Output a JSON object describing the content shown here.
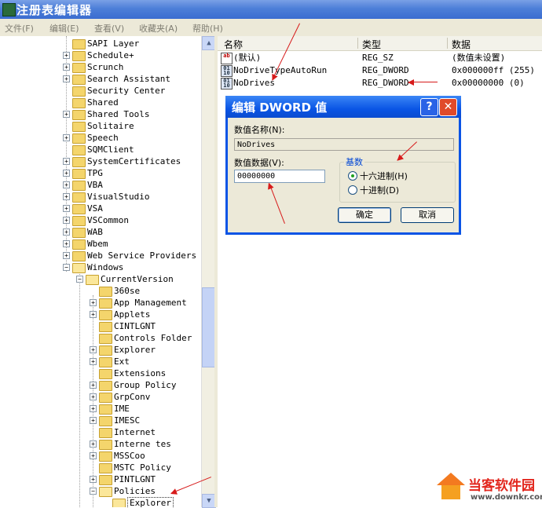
{
  "window": {
    "title": "注册表编辑器"
  },
  "menu": [
    "文件(F)",
    "编辑(E)",
    "查看(V)",
    "收藏夹(A)",
    "帮助(H)"
  ],
  "tree": [
    {
      "label": "SAPI Layer",
      "indent": 0,
      "exp": ""
    },
    {
      "label": "Schedule+",
      "indent": 0,
      "exp": "+"
    },
    {
      "label": "Scrunch",
      "indent": 0,
      "exp": "+"
    },
    {
      "label": "Search Assistant",
      "indent": 0,
      "exp": "+"
    },
    {
      "label": "Security Center",
      "indent": 0,
      "exp": ""
    },
    {
      "label": "Shared",
      "indent": 0,
      "exp": ""
    },
    {
      "label": "Shared Tools",
      "indent": 0,
      "exp": "+"
    },
    {
      "label": "Solitaire",
      "indent": 0,
      "exp": ""
    },
    {
      "label": "Speech",
      "indent": 0,
      "exp": "+"
    },
    {
      "label": "SQMClient",
      "indent": 0,
      "exp": ""
    },
    {
      "label": "SystemCertificates",
      "indent": 0,
      "exp": "+"
    },
    {
      "label": "TPG",
      "indent": 0,
      "exp": "+"
    },
    {
      "label": "VBA",
      "indent": 0,
      "exp": "+"
    },
    {
      "label": "VisualStudio",
      "indent": 0,
      "exp": "+"
    },
    {
      "label": "VSA",
      "indent": 0,
      "exp": "+"
    },
    {
      "label": "VSCommon",
      "indent": 0,
      "exp": "+"
    },
    {
      "label": "WAB",
      "indent": 0,
      "exp": "+"
    },
    {
      "label": "Wbem",
      "indent": 0,
      "exp": "+"
    },
    {
      "label": "Web Service Providers",
      "indent": 0,
      "exp": "+"
    },
    {
      "label": "Windows",
      "indent": 0,
      "exp": "-",
      "open": true
    },
    {
      "label": "CurrentVersion",
      "indent": 1,
      "exp": "-",
      "open": true
    },
    {
      "label": "360se",
      "indent": 2,
      "exp": ""
    },
    {
      "label": "App Management",
      "indent": 2,
      "exp": "+"
    },
    {
      "label": "Applets",
      "indent": 2,
      "exp": "+"
    },
    {
      "label": "CINTLGNT",
      "indent": 2,
      "exp": ""
    },
    {
      "label": "Controls Folder",
      "indent": 2,
      "exp": ""
    },
    {
      "label": "Explorer",
      "indent": 2,
      "exp": "+"
    },
    {
      "label": "Ext",
      "indent": 2,
      "exp": "+"
    },
    {
      "label": "Extensions",
      "indent": 2,
      "exp": ""
    },
    {
      "label": "Group Policy",
      "indent": 2,
      "exp": "+"
    },
    {
      "label": "GrpConv",
      "indent": 2,
      "exp": "+"
    },
    {
      "label": "IME",
      "indent": 2,
      "exp": "+"
    },
    {
      "label": "IMESC",
      "indent": 2,
      "exp": "+"
    },
    {
      "label": "Internet",
      "indent": 2,
      "exp": ""
    },
    {
      "label": "Interne tes",
      "indent": 2,
      "exp": "+"
    },
    {
      "label": "MSSCoo",
      "indent": 2,
      "exp": "+"
    },
    {
      "label": "MSTC Policy",
      "indent": 2,
      "exp": ""
    },
    {
      "label": "PINTLGNT",
      "indent": 2,
      "exp": "+"
    },
    {
      "label": "Policies",
      "indent": 2,
      "exp": "-",
      "open": true
    },
    {
      "label": "Explorer",
      "indent": 3,
      "exp": "",
      "open": true,
      "selected": true
    }
  ],
  "columns": {
    "name": "名称",
    "type": "类型",
    "data": "数据"
  },
  "values": [
    {
      "icon": "ab",
      "name": "(默认)",
      "type": "REG_SZ",
      "data": "(数值未设置)"
    },
    {
      "icon": "dw",
      "name": "NoDriveTypeAutoRun",
      "type": "REG_DWORD",
      "data": "0x000000ff (255)"
    },
    {
      "icon": "dw",
      "name": "NoDrives",
      "type": "REG_DWORD",
      "data": "0x00000000 (0)"
    }
  ],
  "dialog": {
    "title": "编辑 DWORD 值",
    "help": "?",
    "close": "✕",
    "name_label": "数值名称(N):",
    "name_value": "NoDrives",
    "data_label": "数值数据(V):",
    "data_value": "00000000",
    "base_label": "基数",
    "hex_label": "十六进制(H)",
    "dec_label": "十进制(D)",
    "base_selected": "hex",
    "ok": "确定",
    "cancel": "取消"
  },
  "watermark": {
    "name": "当客软件园",
    "url": "www.downkr.com"
  },
  "colors": {
    "annotation": "#d71a1a",
    "title_bar": "#0a55e5"
  }
}
